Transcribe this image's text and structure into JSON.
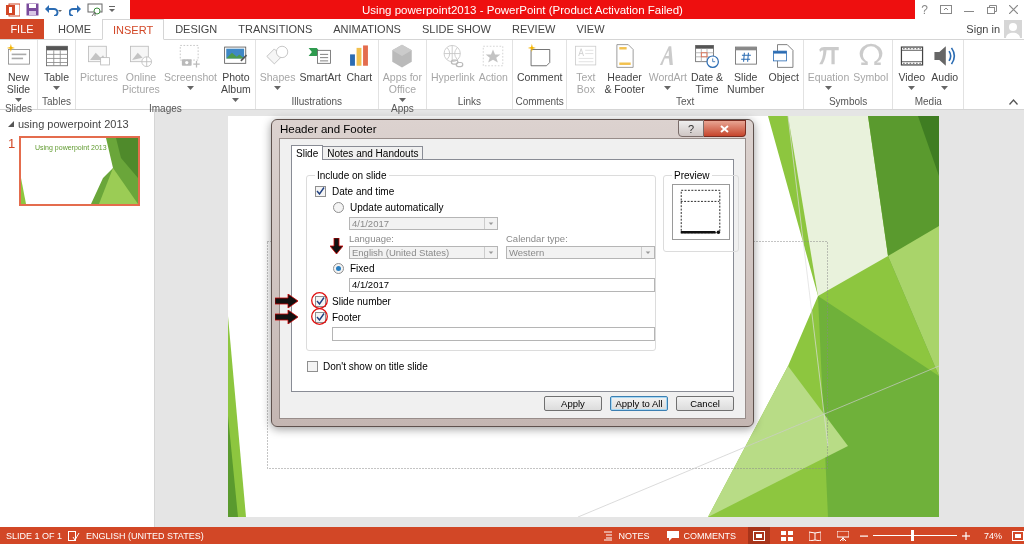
{
  "title_bar": {
    "title": "Using powerpoint2013 -  PowerPoint (Product Activation Failed)",
    "help": "?"
  },
  "ribbon_tabs": [
    {
      "label": "FILE",
      "kind": "file",
      "selected": false
    },
    {
      "label": "HOME",
      "kind": "tab",
      "selected": false
    },
    {
      "label": "INSERT",
      "kind": "tab",
      "selected": true
    },
    {
      "label": "DESIGN",
      "kind": "tab",
      "selected": false
    },
    {
      "label": "TRANSITIONS",
      "kind": "tab",
      "selected": false
    },
    {
      "label": "ANIMATIONS",
      "kind": "tab",
      "selected": false
    },
    {
      "label": "SLIDE SHOW",
      "kind": "tab",
      "selected": false
    },
    {
      "label": "REVIEW",
      "kind": "tab",
      "selected": false
    },
    {
      "label": "VIEW",
      "kind": "tab",
      "selected": false
    }
  ],
  "account": {
    "label": "Sign in"
  },
  "ribbon_groups": [
    {
      "label": "Slides",
      "commands": [
        {
          "lines": [
            "New",
            "Slide"
          ],
          "dropdown": true,
          "disabled": false
        }
      ]
    },
    {
      "label": "Tables",
      "commands": [
        {
          "lines": [
            "Table"
          ],
          "dropdown": true,
          "disabled": false
        }
      ]
    },
    {
      "label": "Images",
      "commands": [
        {
          "lines": [
            "Pictures"
          ],
          "dropdown": false,
          "disabled": true
        },
        {
          "lines": [
            "Online",
            "Pictures"
          ],
          "dropdown": false,
          "disabled": true
        },
        {
          "lines": [
            "Screenshot"
          ],
          "dropdown": true,
          "disabled": true
        },
        {
          "lines": [
            "Photo",
            "Album"
          ],
          "dropdown": true,
          "disabled": false
        }
      ]
    },
    {
      "label": "Illustrations",
      "commands": [
        {
          "lines": [
            "Shapes"
          ],
          "dropdown": true,
          "disabled": true
        },
        {
          "lines": [
            "SmartArt"
          ],
          "dropdown": false,
          "disabled": false
        },
        {
          "lines": [
            "Chart"
          ],
          "dropdown": false,
          "disabled": false
        }
      ]
    },
    {
      "label": "Apps",
      "commands": [
        {
          "lines": [
            "Apps for",
            "Office"
          ],
          "dropdown": true,
          "disabled": true
        }
      ]
    },
    {
      "label": "Links",
      "commands": [
        {
          "lines": [
            "Hyperlink"
          ],
          "dropdown": false,
          "disabled": true
        },
        {
          "lines": [
            "Action"
          ],
          "dropdown": false,
          "disabled": true
        }
      ]
    },
    {
      "label": "Comments",
      "commands": [
        {
          "lines": [
            "Comment"
          ],
          "dropdown": false,
          "disabled": false
        }
      ]
    },
    {
      "label": "Text",
      "commands": [
        {
          "lines": [
            "Text",
            "Box"
          ],
          "dropdown": false,
          "disabled": true
        },
        {
          "lines": [
            "Header",
            "& Footer"
          ],
          "dropdown": false,
          "disabled": false
        },
        {
          "lines": [
            "WordArt"
          ],
          "dropdown": true,
          "disabled": true
        },
        {
          "lines": [
            "Date &",
            "Time"
          ],
          "dropdown": false,
          "disabled": false
        },
        {
          "lines": [
            "Slide",
            "Number"
          ],
          "dropdown": false,
          "disabled": false
        },
        {
          "lines": [
            "Object"
          ],
          "dropdown": false,
          "disabled": false
        }
      ]
    },
    {
      "label": "Symbols",
      "commands": [
        {
          "lines": [
            "Equation"
          ],
          "dropdown": true,
          "disabled": true
        },
        {
          "lines": [
            "Symbol"
          ],
          "dropdown": false,
          "disabled": true
        }
      ]
    },
    {
      "label": "Media",
      "commands": [
        {
          "lines": [
            "Video"
          ],
          "dropdown": true,
          "disabled": false
        },
        {
          "lines": [
            "Audio"
          ],
          "dropdown": true,
          "disabled": false
        }
      ]
    }
  ],
  "slide_pane": {
    "section": {
      "label": "using powerpoint 2013",
      "expanded": true
    },
    "slides": [
      {
        "number": "1",
        "selected": true,
        "thumbnail_text": "Using powerpoint  2013"
      }
    ]
  },
  "dialog": {
    "title": "Header and Footer",
    "help": "?",
    "tabs": [
      {
        "label": "Slide",
        "selected": true
      },
      {
        "label": "Notes and Handouts",
        "selected": false
      }
    ],
    "group_label": "Include on slide",
    "date_and_time": {
      "label": "Date and time",
      "checked": true
    },
    "update_automatically": {
      "label": "Update automatically",
      "selected": false
    },
    "date_format": {
      "value": "4/1/2017",
      "disabled": true
    },
    "language": {
      "label": "Language:",
      "value": "English (United States)",
      "disabled": true
    },
    "calendar_type": {
      "label": "Calendar type:",
      "value": "Western",
      "disabled": true
    },
    "fixed": {
      "label": "Fixed",
      "selected": true
    },
    "fixed_date": {
      "value": "4/1/2017"
    },
    "slide_number": {
      "label": "Slide number",
      "checked": true
    },
    "footer": {
      "label": "Footer",
      "checked": true
    },
    "dont_show_on_title_slide": {
      "label": "Don't show on title slide",
      "checked": false
    },
    "preview_label": "Preview",
    "buttons": [
      {
        "label": "Apply",
        "default": false
      },
      {
        "label": "Apply to All",
        "default": true
      },
      {
        "label": "Cancel",
        "default": false
      }
    ]
  },
  "status_bar": {
    "slide": "SLIDE 1 OF 1",
    "language": "ENGLISH (UNITED STATES)",
    "notes": "NOTES",
    "comments": "COMMENTS",
    "views": [
      {
        "selected": true
      },
      {
        "selected": false
      },
      {
        "selected": false
      },
      {
        "selected": false
      }
    ],
    "zoom": {
      "level": 0.46,
      "reading": "74%"
    }
  }
}
